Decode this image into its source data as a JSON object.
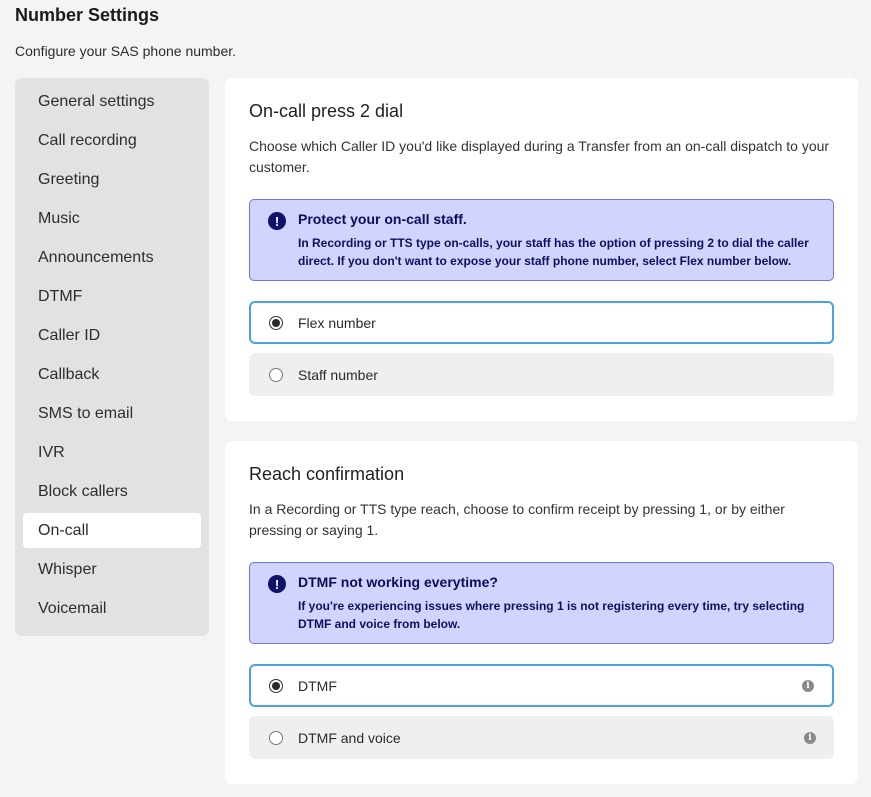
{
  "page": {
    "title": "Number Settings",
    "subtitle": "Configure your SAS phone number."
  },
  "sidebar": {
    "items": [
      {
        "label": "General settings"
      },
      {
        "label": "Call recording"
      },
      {
        "label": "Greeting"
      },
      {
        "label": "Music"
      },
      {
        "label": "Announcements"
      },
      {
        "label": "DTMF"
      },
      {
        "label": "Caller ID"
      },
      {
        "label": "Callback"
      },
      {
        "label": "SMS to email"
      },
      {
        "label": "IVR"
      },
      {
        "label": "Block callers"
      },
      {
        "label": "On-call"
      },
      {
        "label": "Whisper"
      },
      {
        "label": "Voicemail"
      }
    ],
    "active": "On-call"
  },
  "oncall": {
    "title": "On-call press 2 dial",
    "description": "Choose which Caller ID you'd like displayed during a Transfer from an on-call dispatch to your customer.",
    "alert": {
      "icon": "exclamation-icon",
      "title": "Protect your on-call staff.",
      "body": "In Recording or TTS type on-calls, your staff has the option of pressing 2 to dial the caller direct. If you don't want to expose your staff phone number, select Flex number below."
    },
    "options": [
      {
        "label": "Flex number",
        "selected": true
      },
      {
        "label": "Staff number",
        "selected": false
      }
    ]
  },
  "reach": {
    "title": "Reach confirmation",
    "description": "In a Recording or TTS type reach, choose to confirm receipt by pressing 1, or by either pressing or saying 1.",
    "alert": {
      "icon": "exclamation-icon",
      "title": "DTMF not working everytime?",
      "body": "If you're experiencing issues where pressing 1 is not registering every time, try selecting DTMF and voice from below."
    },
    "options": [
      {
        "label": "DTMF",
        "selected": true,
        "info_icon": "info-icon"
      },
      {
        "label": "DTMF and voice",
        "selected": false,
        "info_icon": "info-icon"
      }
    ]
  },
  "colors": {
    "alert_bg": "#d0d4ff",
    "alert_border": "#6f78d8",
    "alert_text": "#0b0d5c",
    "selected_border": "#4aa3df",
    "sidebar_bg": "#e2e2e2"
  }
}
